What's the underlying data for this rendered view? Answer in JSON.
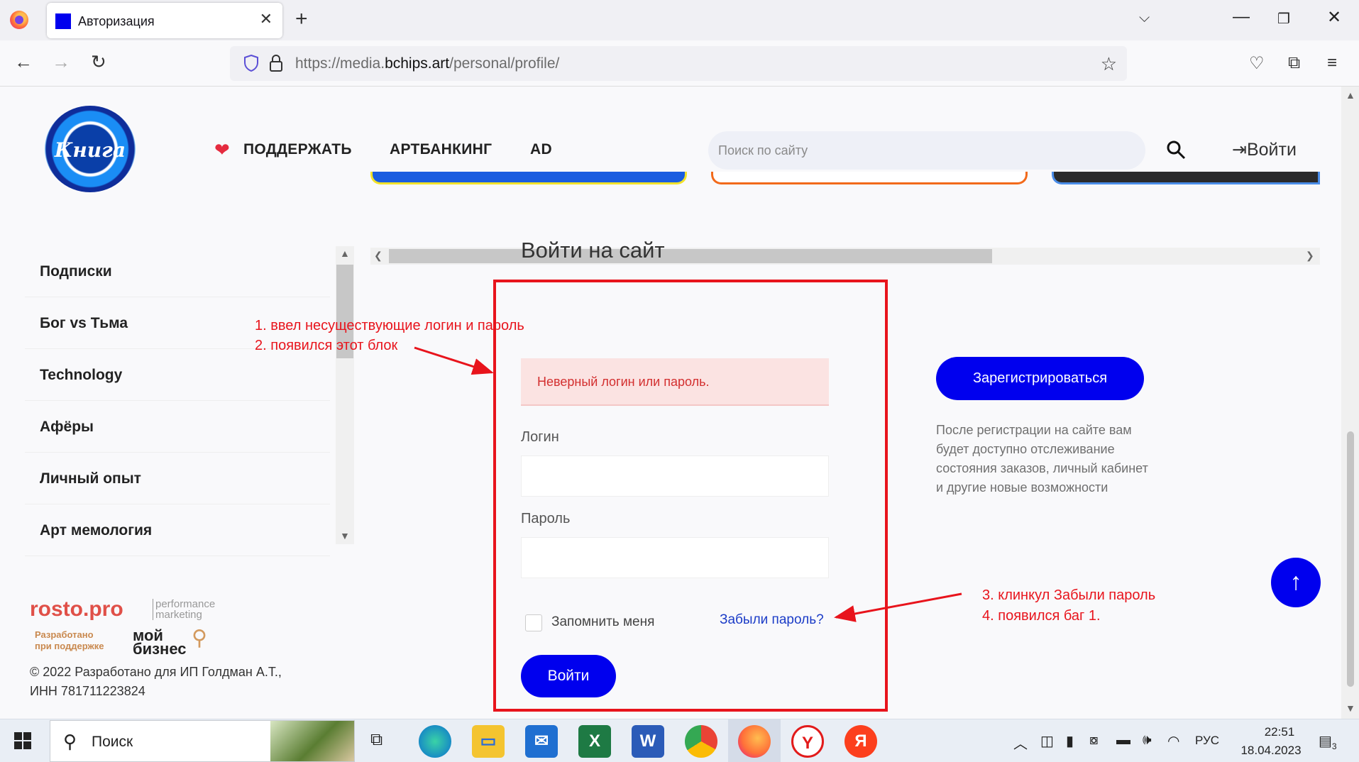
{
  "browser": {
    "tab_title": "Авторизация",
    "url_prefix": "https://media.",
    "url_domain": "bchips.art",
    "url_path": "/personal/profile/"
  },
  "header": {
    "support_label": "ПОДДЕРЖАТЬ",
    "artbanking_label": "АРТБАНКИНГ",
    "ad_label": "AD",
    "search_placeholder": "Поиск по сайту",
    "login_label": "Войти",
    "logo_text": "Книга"
  },
  "sidebar": {
    "items": [
      {
        "label": "Подписки"
      },
      {
        "label": "Бог vs Тьма"
      },
      {
        "label": "Technology"
      },
      {
        "label": "Афёры"
      },
      {
        "label": "Личный опыт"
      },
      {
        "label": "Арт мемология"
      }
    ]
  },
  "login": {
    "title": "Войти на сайт",
    "error": "Неверный логин или пароль.",
    "login_label": "Логин",
    "password_label": "Пароль",
    "remember_label": "Запомнить меня",
    "forgot_label": "Забыли пароль?",
    "submit_label": "Войти"
  },
  "register": {
    "button_label": "Зарегистрироваться",
    "note": "После регистрации на сайте вам будет доступно отслеживание состояния заказов, личный кабинет и другие новые возможности"
  },
  "footer": {
    "rosto": "rosto.pro",
    "rosto_sub1": "performance",
    "rosto_sub2": "marketing",
    "biz_note1": "Разработано",
    "biz_note2": "при поддержке",
    "biz_logo1": "мой",
    "biz_logo2": "бизнес",
    "copyright1": "© 2022 Разработано для ИП Голдман А.Т.,",
    "copyright2": "ИНН 781711223824"
  },
  "annotations": {
    "a1": "1. ввел несуществующие логин и пароль",
    "a2": "2. появился этот блок",
    "a3": "3. клинкул Забыли пароль",
    "a4": "4. появился баг 1.",
    "color": "#e8141c"
  },
  "taskbar": {
    "search_label": "Поиск",
    "lang": "РУС",
    "time": "22:51",
    "date": "18.04.2023",
    "notification_count": "3"
  },
  "colors": {
    "accent": "#0000ee",
    "error_bg": "#fbe3e2",
    "error_text": "#d32f2f"
  }
}
